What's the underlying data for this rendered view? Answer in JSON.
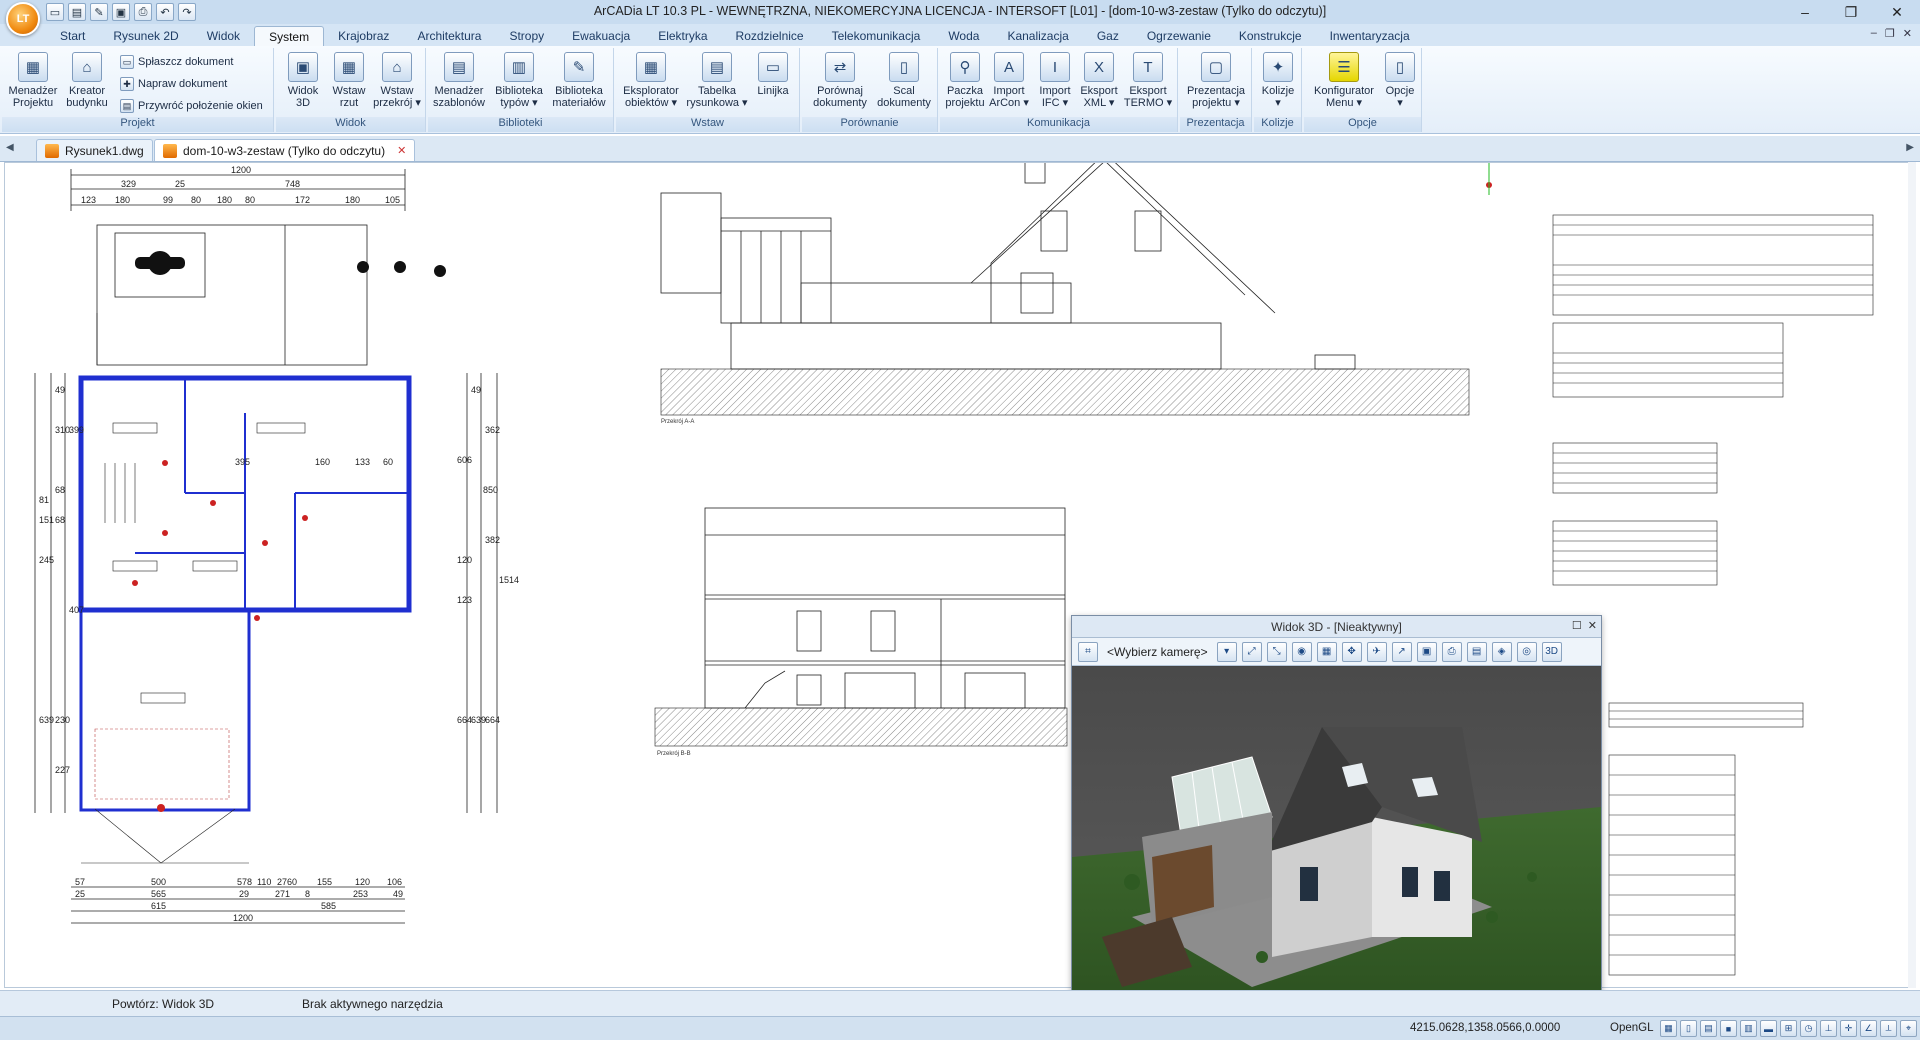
{
  "app": {
    "logo_text": "LT",
    "title": "ArCADia LT 10.3 PL - WEWNĘTRZNA, NIEKOMERCYJNA LICENCJA - INTERSOFT [L01] - [dom-10-w3-zestaw (Tylko do odczytu)]"
  },
  "quick_access": [
    "new-icon",
    "open-icon",
    "edit-icon",
    "save-icon",
    "print-icon",
    "undo-icon",
    "redo-icon"
  ],
  "window_controls": [
    "–",
    "❐",
    "✕"
  ],
  "ribbon": {
    "tabs": [
      "Start",
      "Rysunek 2D",
      "Widok",
      "System",
      "Krajobraz",
      "Architektura",
      "Stropy",
      "Ewakuacja",
      "Elektryka",
      "Rozdzielnice",
      "Telekomunikacja",
      "Woda",
      "Kanalizacja",
      "Gaz",
      "Ogrzewanie",
      "Konstrukcje",
      "Inwentaryzacja"
    ],
    "active_tab": "System",
    "right_controls": [
      "–",
      "❐",
      "✕"
    ],
    "groups": [
      {
        "title": "Projekt"
      },
      {
        "title": "Widok"
      },
      {
        "title": "Biblioteki"
      },
      {
        "title": "Wstaw"
      },
      {
        "title": "Porównanie"
      },
      {
        "title": "Komunikacja"
      },
      {
        "title": "Prezentacja"
      },
      {
        "title": "Kolizje"
      },
      {
        "title": "Opcje"
      }
    ],
    "projekt": {
      "menadzer": "Menadżer\nProjektu",
      "kreator": "Kreator\nbudynku",
      "splaszcz": "Spłaszcz dokument",
      "napraw": "Napraw dokument",
      "przywroc": "Przywróć położenie okien"
    },
    "widok": {
      "widok3d": "Widok\n3D",
      "wstaw_rzut": "Wstaw\nrzut",
      "wstaw_przekroj": "Wstaw\nprzekrój ▾"
    },
    "biblioteki": {
      "menadzer_szablonow": "Menadżer\nszablonów",
      "biblioteka_typow": "Biblioteka\ntypów ▾",
      "biblioteka_materialow": "Biblioteka\nmateriałów"
    },
    "wstaw": {
      "eksplorator": "Eksplorator\nobiektów ▾",
      "tabelka": "Tabelka\nrysunkowa ▾",
      "linijka": "Linijka"
    },
    "porownanie": {
      "porownaj": "Porównaj\ndokumenty",
      "scal": "Scal\ndokumenty"
    },
    "komunikacja": {
      "paczka": "Paczka\nprojektu",
      "import_arcon": "Import\nArCon ▾",
      "import_ifc": "Import\nIFC ▾",
      "eksport_xml": "Eksport\nXML ▾",
      "eksport_termo": "Eksport\nTERMO ▾"
    },
    "prezentacja": {
      "prezentacja": "Prezentacja\nprojektu ▾"
    },
    "kolizje": {
      "kolizje": "Kolizje\n▾"
    },
    "opcje": {
      "konfigurator": "Konfigurator\nMenu ▾",
      "opcje": "Opcje\n▾"
    }
  },
  "doc_tabs": [
    {
      "label": "Rysunek1.dwg"
    },
    {
      "label": "dom-10-w3-zestaw (Tylko do odczytu)"
    }
  ],
  "view3d": {
    "title": "Widok 3D - [Nieaktywny]",
    "camera_placeholder": "<Wybierz kamerę>"
  },
  "status": {
    "repeat": "Powtórz: Widok 3D",
    "tool": "Brak aktywnego narzędzia",
    "coords": "4215.0628,1358.0566,0.0000",
    "renderer": "OpenGL"
  },
  "drawing": {
    "dims_top_total": "1200",
    "dims_top_row1": [
      "329",
      "25",
      "748"
    ],
    "dims_top_row2": [
      "123",
      "180",
      "99",
      "80",
      "180",
      "80",
      "172",
      "180",
      "105"
    ],
    "dims_bottom_row1": [
      "57",
      "500",
      "578",
      "110",
      "2760",
      "155",
      "120",
      "106"
    ],
    "dims_bottom_row2": [
      "25",
      "565",
      "29",
      "271",
      "8",
      "253",
      "49"
    ],
    "dims_bottom_row3": [
      "615",
      "585"
    ],
    "dims_bottom_total": "1200",
    "dims_left": [
      "49",
      "310",
      "399",
      "81",
      "68",
      "151",
      "68",
      "245",
      "407",
      "639",
      "230",
      "227"
    ],
    "dims_right": [
      "49",
      "362",
      "606",
      "850",
      "382",
      "120",
      "123",
      "1514",
      "664",
      "639",
      "664"
    ],
    "interior_dims": [
      "395",
      "160",
      "133",
      "60"
    ],
    "section_label_1": "Przekrój A-A",
    "section_label_2": "Przekrój B-B"
  },
  "colors": {
    "wall_blue": "#1f2fd0",
    "accent_red": "#cc2222",
    "crosshair_green": "#22bb22",
    "ribbon_bg": "#e4eef9"
  }
}
